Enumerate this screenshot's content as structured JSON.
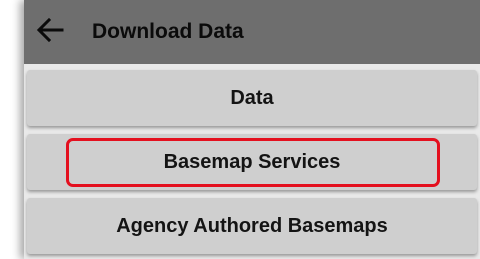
{
  "app_bar": {
    "title": "Download Data",
    "back_icon": "arrow-left-icon"
  },
  "menu": {
    "items": [
      {
        "label": "Data"
      },
      {
        "label": "Basemap Services",
        "highlighted": true
      },
      {
        "label": "Agency Authored Basemaps"
      }
    ]
  },
  "colors": {
    "app_bar": "#6e6e6e",
    "button": "#cfcfcf",
    "highlight": "#e4101f"
  }
}
